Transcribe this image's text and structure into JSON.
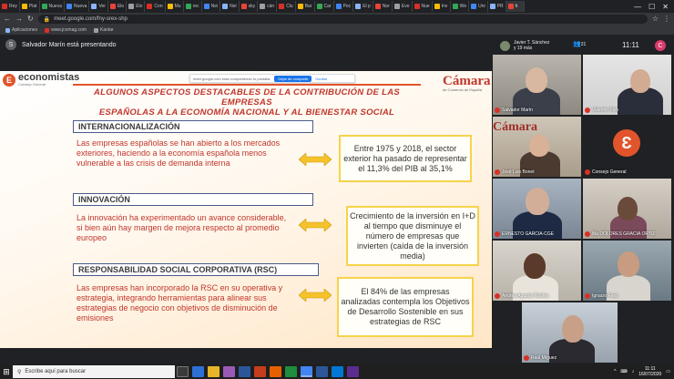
{
  "browser": {
    "tabs": [
      "Rey",
      "Plat",
      "Nueva",
      "Nueva",
      "Ver",
      "Elo",
      "Elo",
      "Con",
      "Mu",
      "rec",
      "Nei",
      "Nei",
      "sky",
      "cán",
      "Clu",
      "Bar",
      "Car",
      "Poc",
      "El p",
      "Nor",
      "Eve",
      "Nue",
      "Inv",
      "We",
      "Uni",
      "PR",
      "h"
    ],
    "active_tab_index": 26,
    "url": "meet.google.com/fny-srex-shp",
    "bookmarks": [
      "Aplicaciones",
      "www.jcomag.com",
      "Kantar"
    ],
    "colors": {
      "chrome": "#202124",
      "toolbar": "#35363a"
    }
  },
  "meet": {
    "presenter_initial": "S",
    "presenter_text": "Salvador Marín está presentando",
    "top_participant": "Javier T. Sánchez",
    "top_participant_more": "y 19 más",
    "people_count": "21",
    "clock": "11:11",
    "user_initial": "C",
    "share_banner": {
      "text": "meet.google.com está compartiendo tu pantalla.",
      "stop_label": "Dejar de compartir",
      "hide_label": "Ocultar"
    },
    "participants": [
      {
        "name": "Salvador Marín"
      },
      {
        "name": "Valentín Pich"
      },
      {
        "name": "José Luis Bonet"
      },
      {
        "name": "Consejo General"
      },
      {
        "name": "ERNESTO GARCIA-CGE"
      },
      {
        "name": "Ma DOLORES GRACIA ORTIZ"
      },
      {
        "name": "Andrea Aguado Robles"
      },
      {
        "name": "Ignacio Faes"
      },
      {
        "name": "Raúl Míguez"
      }
    ]
  },
  "slide": {
    "logo_left": {
      "initial": "E",
      "name": "economistas",
      "sub": "Consejo General"
    },
    "logo_right": {
      "name": "Cámara",
      "sub": "de Comercio de España"
    },
    "title_line1": "ALGUNOS ASPECTOS DESTACABLES DE LA CONTRIBUCIÓN DE LAS EMPRESAS",
    "title_line2": "ESPAÑOLAS A LA ECONOMÍA NACIONAL Y AL BIENESTAR SOCIAL",
    "sections": [
      {
        "header": "INTERNACIONALIZACIÓN",
        "text": "Las empresas españolas se han abierto a los mercados exteriores, haciendo a la economía española menos vulnerable a las crisis de demanda interna",
        "box": "Entre 1975 y 2018, el sector exterior ha pasado de representar el 11,3% del PIB al 35,1%"
      },
      {
        "header": "INNOVACIÓN",
        "text": "La innovación ha experimentado un avance considerable, si bien aún hay margen de mejora respecto al promedio europeo",
        "box": "Crecimiento de la inversión en I+D al tiempo que disminuye el número de empresas que invierten (caída de la inversión media)"
      },
      {
        "header": "RESPONSABILIDAD SOCIAL CORPORATIVA (RSC)",
        "text": "Las empresas han incorporado la RSC en su operativa y estrategia, integrando herramientas para alinear sus estrategias de negocio con objetivos de disminución de emisiones",
        "box": "El 84% de las empresas analizadas contempla los Objetivos de Desarrollo Sostenible en sus estrategias de RSC"
      }
    ],
    "colors": {
      "accent": "#c0362c",
      "box_border": "#f6d34a",
      "header_border": "#4a5a8a"
    }
  },
  "taskbar": {
    "search_placeholder": "Escribe aquí para buscar",
    "time": "11:11",
    "date": "16/07/2020"
  }
}
